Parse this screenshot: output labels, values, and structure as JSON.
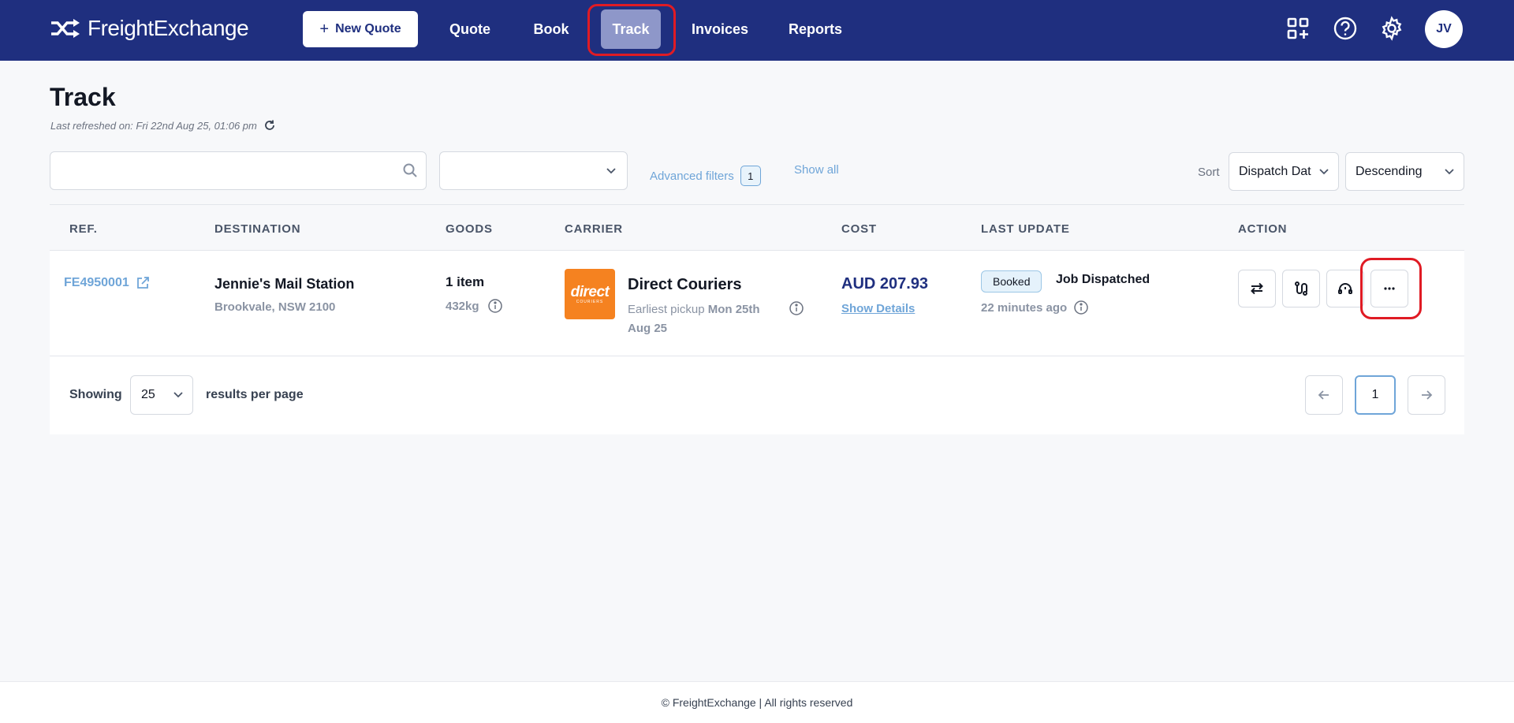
{
  "brand": {
    "name": "FreightExchange"
  },
  "header": {
    "new_quote_label": "New Quote",
    "nav": [
      {
        "label": "Quote",
        "active": false
      },
      {
        "label": "Book",
        "active": false
      },
      {
        "label": "Track",
        "active": true
      },
      {
        "label": "Invoices",
        "active": false
      },
      {
        "label": "Reports",
        "active": false
      }
    ],
    "icons": [
      "apps-add-icon",
      "help-icon",
      "gear-icon"
    ],
    "avatar_initials": "JV"
  },
  "page": {
    "title": "Track",
    "last_refreshed": "Last refreshed on: Fri 22nd Aug 25, 01:06 pm"
  },
  "filters": {
    "search_value": "",
    "status_value": "",
    "advanced_filters_label": "Advanced filters",
    "advanced_filters_count": "1",
    "show_all_label": "Show all",
    "sort_label": "Sort",
    "sort_by": "Dispatch Dat",
    "sort_order": "Descending"
  },
  "table": {
    "columns": [
      "REF.",
      "DESTINATION",
      "GOODS",
      "CARRIER",
      "COST",
      "LAST UPDATE",
      "ACTION"
    ],
    "rows": [
      {
        "ref": "FE4950001",
        "destination_name": "Jennie's Mail Station",
        "destination_address": "Brookvale, NSW 2100",
        "goods_items": "1 item",
        "goods_weight": "432kg",
        "carrier_logo_text": "direct",
        "carrier_logo_subtext": "COURIERS",
        "carrier_name": "Direct Couriers",
        "pickup_label": "Earliest pickup",
        "pickup_date": "Mon 25th Aug 25",
        "cost": "AUD 207.93",
        "show_details_label": "Show Details",
        "status_badge": "Booked",
        "status_text": "Job Dispatched",
        "status_time": "22 minutes ago",
        "actions": [
          "swap-icon",
          "route-icon",
          "support-icon",
          "more-icon"
        ]
      }
    ]
  },
  "pagination": {
    "showing_label": "Showing",
    "per_page": "25",
    "per_page_label": "results per page",
    "current_page": "1"
  },
  "footer": {
    "text": "© FreightExchange | All rights reserved"
  },
  "colors": {
    "header_bg": "#1f2f7f",
    "nav_active_bg": "#8e97c9",
    "link": "#6fa5d8",
    "highlight_red": "#e01b24",
    "carrier_orange": "#f58220"
  }
}
